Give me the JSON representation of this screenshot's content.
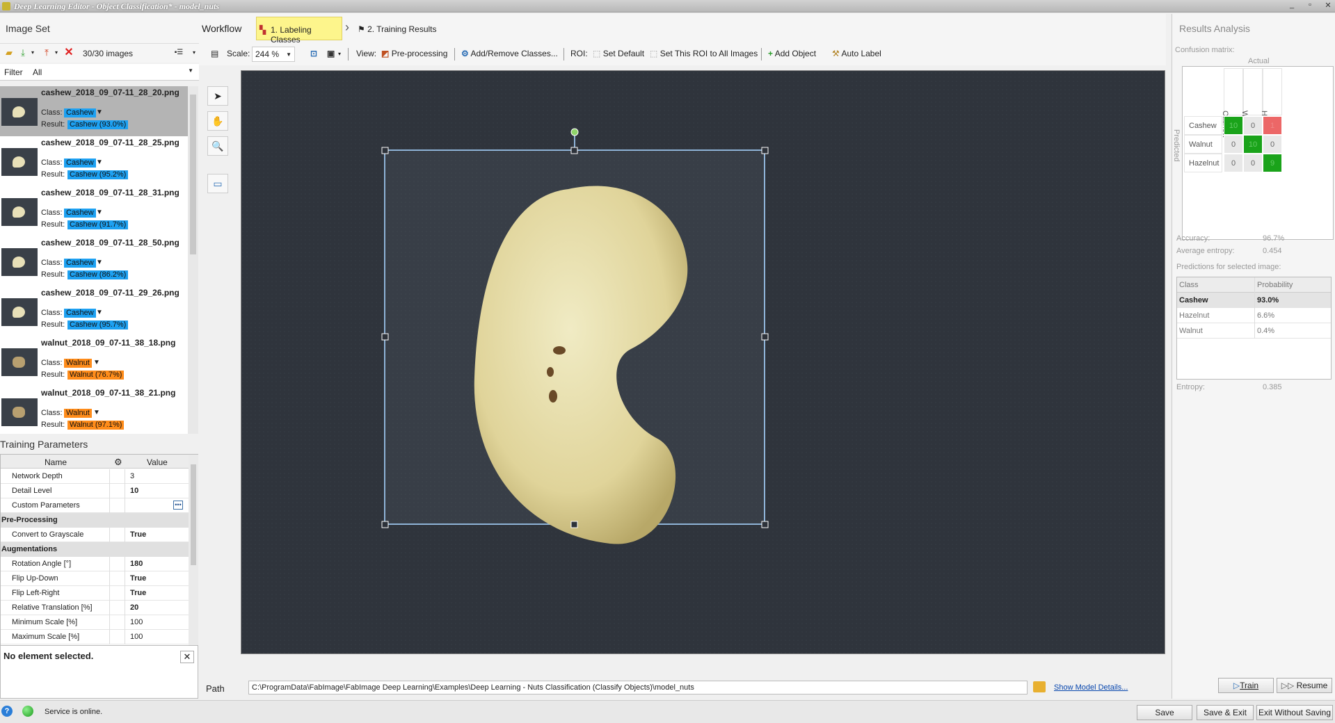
{
  "window": {
    "title": "Deep Learning Editor - Object Classification* - model_nuts",
    "controls": [
      "_",
      "▫",
      "✕"
    ]
  },
  "image_set": {
    "title": "Image Set",
    "count": "30/30 images",
    "filter_label": "Filter",
    "filter_value": "All",
    "class_label": "Class:",
    "result_label": "Result:",
    "items": [
      {
        "file": "cashew_2018_09_07-11_28_20.png",
        "class": "Cashew",
        "result": "Cashew (93.0%)",
        "kind": "cashew"
      },
      {
        "file": "cashew_2018_09_07-11_28_25.png",
        "class": "Cashew",
        "result": "Cashew (95.2%)",
        "kind": "cashew"
      },
      {
        "file": "cashew_2018_09_07-11_28_31.png",
        "class": "Cashew",
        "result": "Cashew (91.7%)",
        "kind": "cashew"
      },
      {
        "file": "cashew_2018_09_07-11_28_50.png",
        "class": "Cashew",
        "result": "Cashew (86.2%)",
        "kind": "cashew"
      },
      {
        "file": "cashew_2018_09_07-11_29_26.png",
        "class": "Cashew",
        "result": "Cashew (95.7%)",
        "kind": "cashew"
      },
      {
        "file": "walnut_2018_09_07-11_38_18.png",
        "class": "Walnut",
        "result": "Walnut (76.7%)",
        "kind": "walnut"
      },
      {
        "file": "walnut_2018_09_07-11_38_21.png",
        "class": "Walnut",
        "result": "Walnut (97.1%)",
        "kind": "walnut"
      }
    ]
  },
  "training": {
    "title": "Training Parameters",
    "col_name": "Name",
    "col_value": "Value",
    "rows": [
      {
        "type": "param",
        "name": "Network Depth",
        "value": "3",
        "bold": false
      },
      {
        "type": "param",
        "name": "Detail Level",
        "value": "10",
        "bold": true
      },
      {
        "type": "param",
        "name": "Custom Parameters",
        "value": "",
        "bold": false,
        "dots": true
      },
      {
        "type": "cat",
        "name": "Pre-Processing"
      },
      {
        "type": "param",
        "name": "Convert to Grayscale",
        "value": "True",
        "bold": true
      },
      {
        "type": "cat",
        "name": "Augmentations"
      },
      {
        "type": "param",
        "name": "Rotation Angle [°]",
        "value": "180",
        "bold": true
      },
      {
        "type": "param",
        "name": "Flip Up-Down",
        "value": "True",
        "bold": true
      },
      {
        "type": "param",
        "name": "Flip Left-Right",
        "value": "True",
        "bold": true
      },
      {
        "type": "param",
        "name": "Relative Translation [%]",
        "value": "20",
        "bold": true
      },
      {
        "type": "param",
        "name": "Minimum Scale [%]",
        "value": "100",
        "bold": false
      },
      {
        "type": "param",
        "name": "Maximum Scale [%]",
        "value": "100",
        "bold": false
      }
    ],
    "no_selection": "No element selected."
  },
  "workflow": {
    "label": "Workflow",
    "step1": "1. Labeling Classes",
    "step2": "2. Training Results"
  },
  "toolbar": {
    "scale_label": "Scale:",
    "scale_value": "244 %",
    "view_label": "View:",
    "preprocessing": "Pre-processing",
    "add_remove_classes": "Add/Remove Classes...",
    "roi_label": "ROI:",
    "set_default": "Set Default",
    "set_roi_all": "Set This ROI to All Images",
    "add_object": "Add Object",
    "auto_label": "Auto Label"
  },
  "path": {
    "label": "Path",
    "value": "C:\\ProgramData\\FabImage\\FabImage Deep Learning\\Examples\\Deep Learning - Nuts Classification (Classify Objects)\\model_nuts",
    "details_link": "Show Model Details..."
  },
  "results": {
    "title": "Results Analysis",
    "confusion_label": "Confusion matrix:",
    "actual_label": "Actual",
    "predicted_label": "Predicted",
    "classes": [
      "Cashew",
      "Walnut",
      "Hazelnut"
    ],
    "matrix": [
      [
        {
          "v": "10",
          "c": "g"
        },
        {
          "v": "0",
          "c": ""
        },
        {
          "v": "1",
          "c": "r"
        }
      ],
      [
        {
          "v": "0",
          "c": ""
        },
        {
          "v": "10",
          "c": "g"
        },
        {
          "v": "0",
          "c": ""
        }
      ],
      [
        {
          "v": "0",
          "c": ""
        },
        {
          "v": "0",
          "c": ""
        },
        {
          "v": "9",
          "c": "g"
        }
      ]
    ],
    "accuracy_label": "Accuracy:",
    "accuracy": "96.7%",
    "avg_entropy_label": "Average entropy:",
    "avg_entropy": "0.454",
    "predictions_label": "Predictions for selected image:",
    "pred_col_class": "Class",
    "pred_col_prob": "Probability",
    "predictions": [
      {
        "cls": "Cashew",
        "p": "93.0%"
      },
      {
        "cls": "Hazelnut",
        "p": "6.6%"
      },
      {
        "cls": "Walnut",
        "p": "0.4%"
      }
    ],
    "entropy_label": "Entropy:",
    "entropy": "0.385",
    "train_btn": "Train",
    "resume_btn": "Resume"
  },
  "status": {
    "help": "?",
    "text": "Service is online.",
    "save": "Save",
    "save_exit": "Save & Exit",
    "exit_no_save": "Exit Without Saving"
  },
  "colors": {
    "cashew_tag": "#1da1f2",
    "walnut_tag": "#ff8c1a",
    "step_highlight": "#fdf58c",
    "matrix_correct": "#1aa31a",
    "matrix_error": "#ec6767"
  }
}
